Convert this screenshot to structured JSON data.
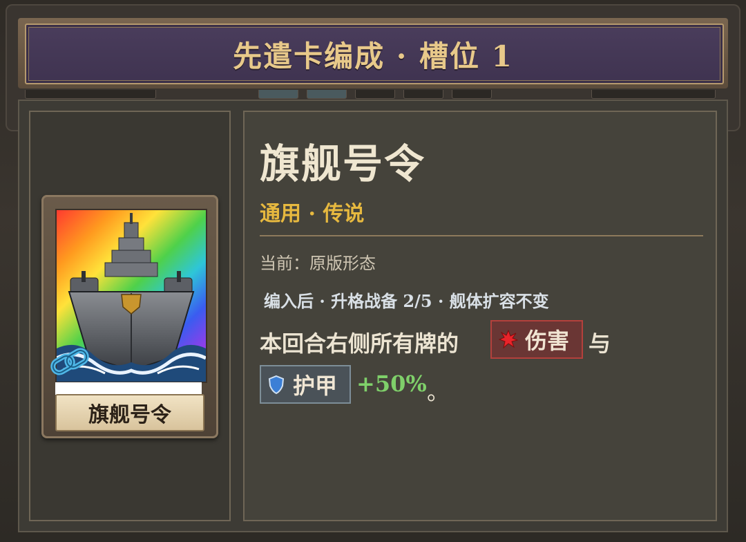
{
  "header": {
    "title": "先遣卡编成 · 槽位 1"
  },
  "card": {
    "name": "旗舰号令",
    "art_theme": "rainbow-battleship",
    "linked_icon": "chain-link-icon"
  },
  "details": {
    "title": "旗舰号令",
    "subtitle": "通用 · 传说",
    "current_label": "当前：原版形态",
    "upgrade_line": "编入后 · 升格战备 2/5 · 舰体扩容不变",
    "effect_prefix": "本回合右侧所有牌的",
    "damage_tag": "伤害",
    "conjunction": "与",
    "armor_tag": "护甲",
    "bonus": "+50%",
    "period": "。"
  },
  "colors": {
    "title_gold": "#e8c98a",
    "rarity_gold": "#e7b93f",
    "bonus_green": "#7fd06a",
    "damage_red": "#b4403c",
    "armor_steel": "#7d8e98"
  }
}
